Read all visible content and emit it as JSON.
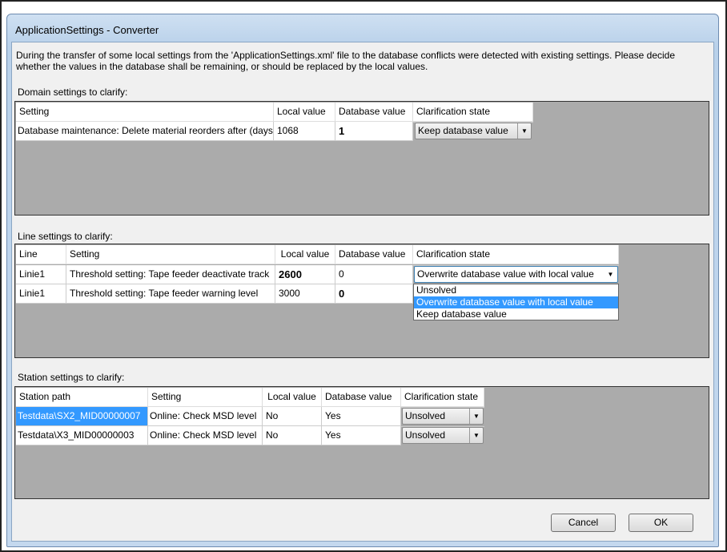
{
  "window": {
    "title": "ApplicationSettings - Converter"
  },
  "message": "During the transfer of some local settings from the 'ApplicationSettings.xml' file to the database conflicts were detected with existing settings. Please decide whether the values in the database shall be remaining, or should be replaced by the local values.",
  "domain": {
    "label": "Domain settings to clarify:",
    "headers": [
      "Setting",
      "Local value",
      "Database value",
      "Clarification state"
    ],
    "rows": [
      {
        "setting": "Database maintenance: Delete material reorders after (days)",
        "local": "1068",
        "db": "1",
        "state": "Keep database value"
      }
    ]
  },
  "line": {
    "label": "Line settings to clarify:",
    "headers": [
      "Line",
      "Setting",
      "Local value",
      "Database value",
      "Clarification state"
    ],
    "rows": [
      {
        "line": "Linie1",
        "setting": "Threshold setting: Tape feeder deactivate track",
        "local": "2600",
        "db": "0",
        "state": "Overwrite database value with local value"
      },
      {
        "line": "Linie1",
        "setting": "Threshold setting: Tape feeder warning level",
        "local": "3000",
        "db": "0",
        "state": ""
      }
    ],
    "dropdown_options": [
      "Unsolved",
      "Overwrite database value with local value",
      "Keep database value"
    ]
  },
  "station": {
    "label": "Station settings to clarify:",
    "headers": [
      "Station path",
      "Setting",
      "Local value",
      "Database value",
      "Clarification state"
    ],
    "rows": [
      {
        "path": "Testdata\\SX2_MID00000007",
        "setting": "Online: Check MSD level",
        "local": "No",
        "db": "Yes",
        "state": "Unsolved"
      },
      {
        "path": "Testdata\\X3_MID00000003",
        "setting": "Online: Check MSD level",
        "local": "No",
        "db": "Yes",
        "state": "Unsolved"
      }
    ]
  },
  "buttons": {
    "cancel": "Cancel",
    "ok": "OK"
  }
}
